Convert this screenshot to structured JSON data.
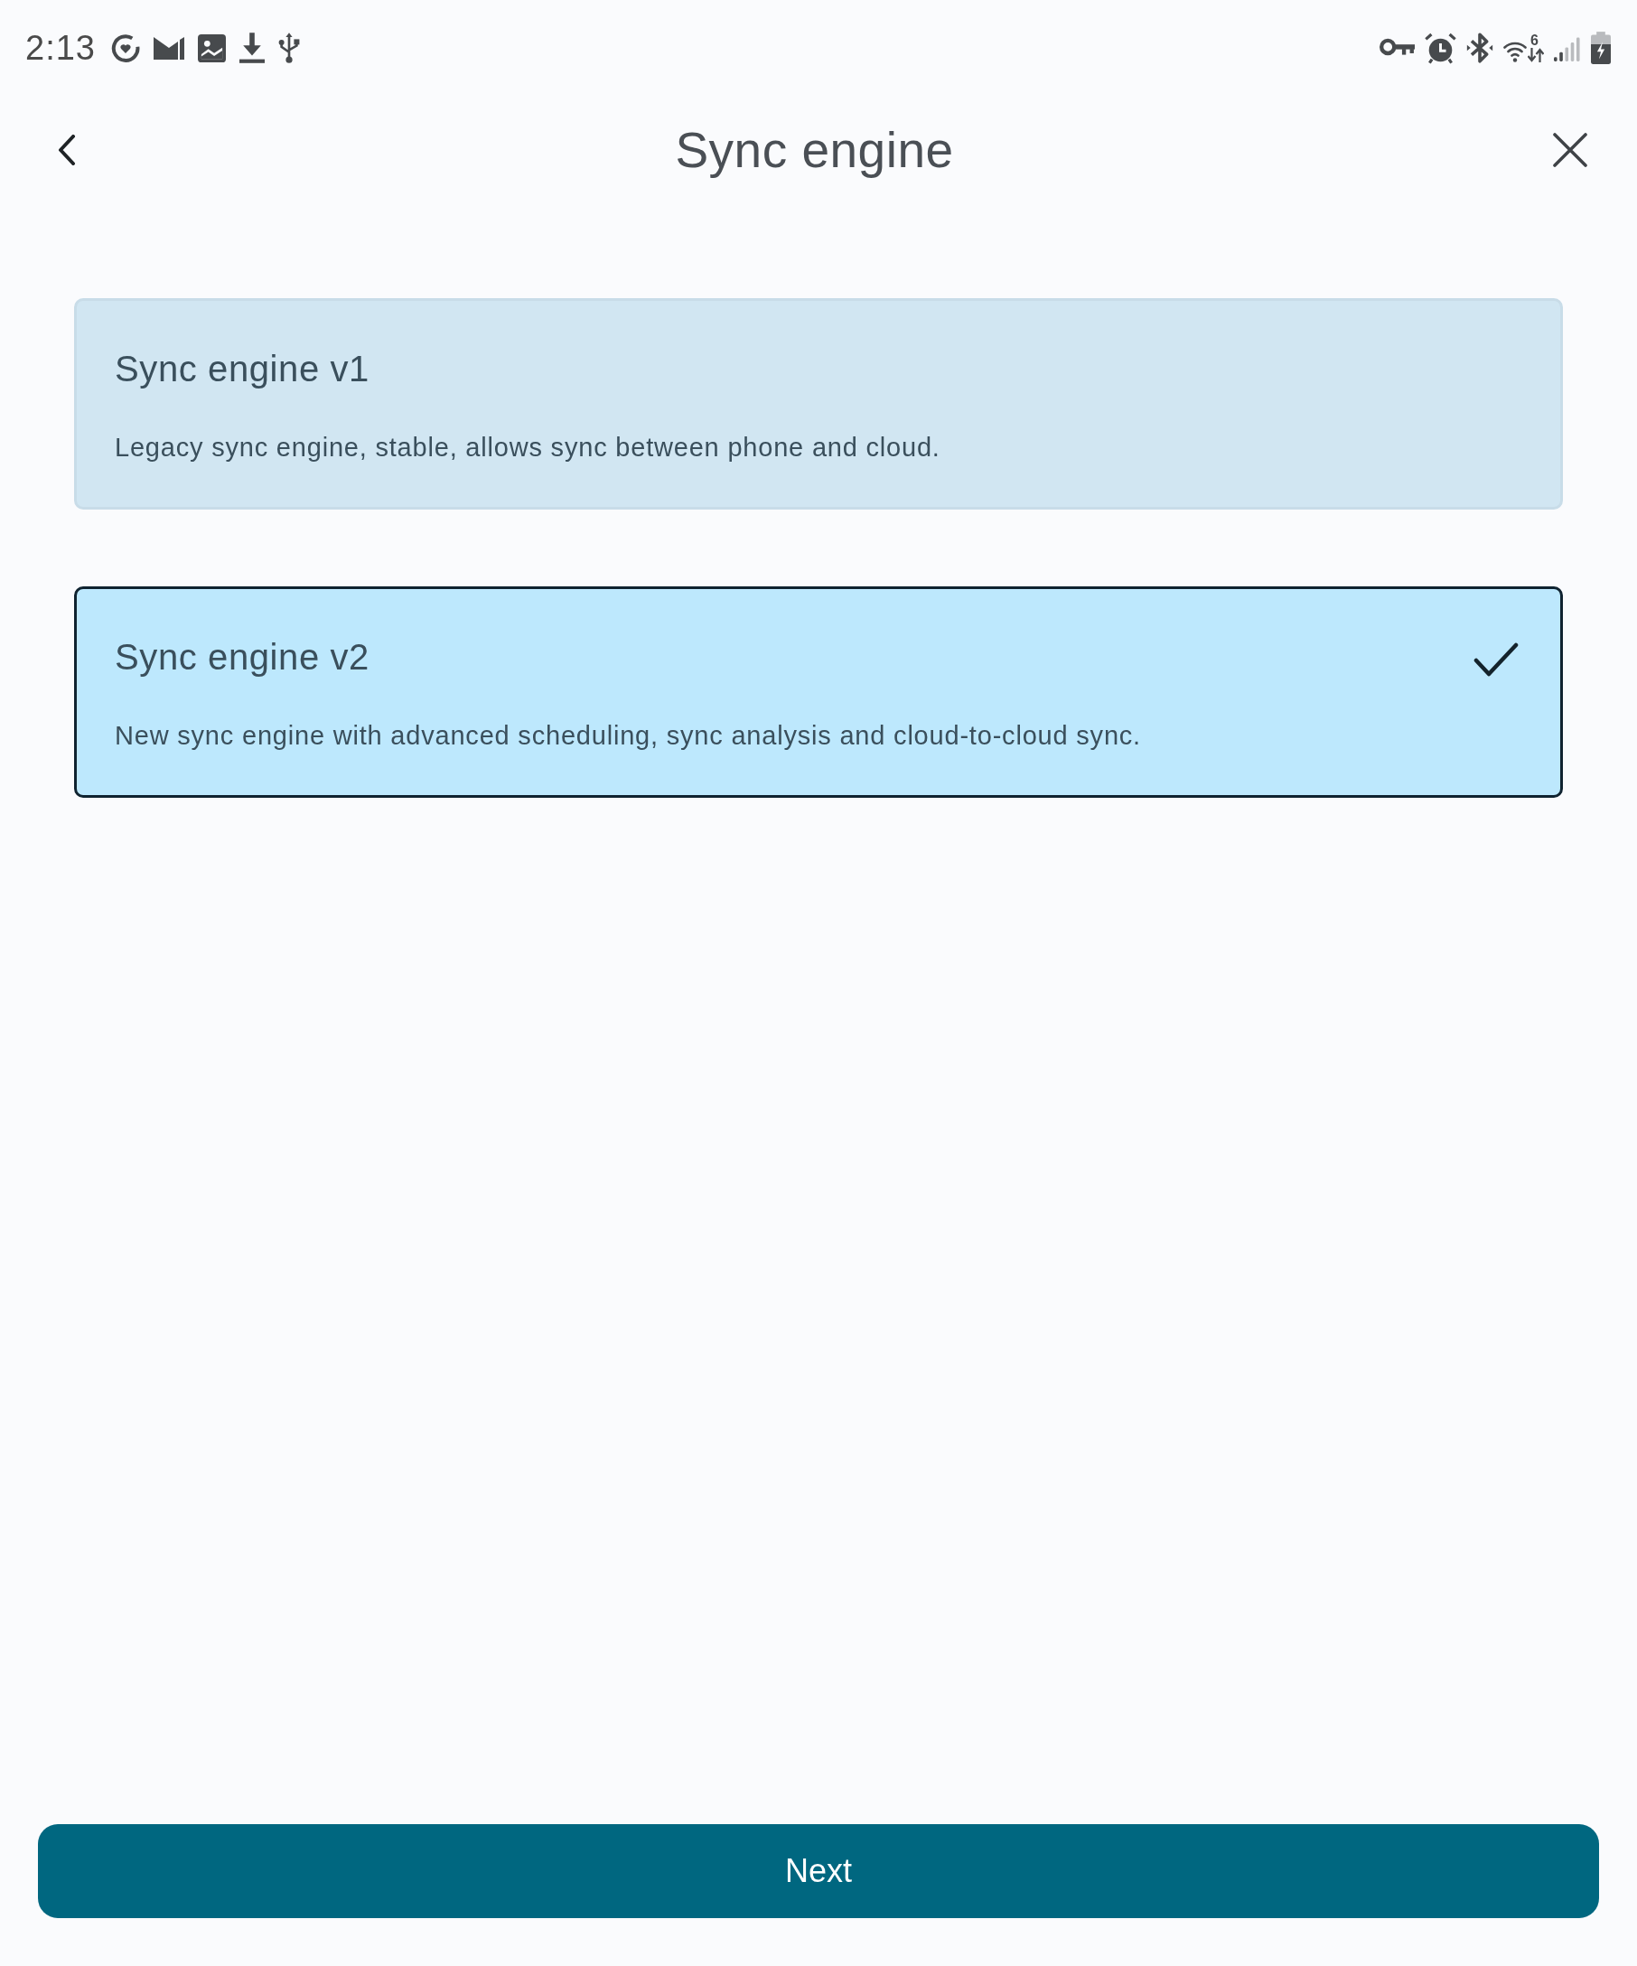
{
  "status_bar": {
    "time": "2:13",
    "wifi_label": "6"
  },
  "header": {
    "title": "Sync engine"
  },
  "options": [
    {
      "title": "Sync engine v1",
      "description": "Legacy sync engine, stable, allows sync between phone and cloud.",
      "selected": false
    },
    {
      "title": "Sync engine v2",
      "description": "New sync engine with advanced scheduling, sync analysis and cloud-to-cloud sync.",
      "selected": true
    }
  ],
  "buttons": [
    {
      "label": "Next"
    }
  ]
}
